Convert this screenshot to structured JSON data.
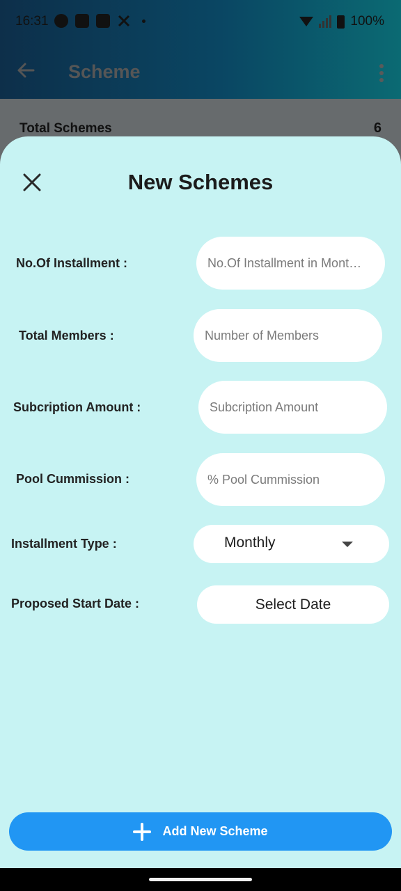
{
  "status_bar": {
    "time": "16:31",
    "battery": "100%"
  },
  "app_bar": {
    "title": "Scheme"
  },
  "summary": {
    "label": "Total Schemes",
    "value": "6"
  },
  "sheet": {
    "title": "New Schemes",
    "fields": {
      "installments": {
        "label": "No.Of Installment :",
        "placeholder": "No.Of Installment in Mont…",
        "value": ""
      },
      "members": {
        "label": "Total Members :",
        "placeholder": "Number of Members",
        "value": ""
      },
      "subscription": {
        "label": "Subcription Amount :",
        "placeholder": "Subcription Amount",
        "value": ""
      },
      "commission": {
        "label": "Pool Cummission :",
        "placeholder": "% Pool Cummission",
        "value": ""
      }
    },
    "installment_type": {
      "label": "Installment Type :",
      "selected": "Monthly"
    },
    "start_date": {
      "label": "Proposed Start Date :",
      "button": "Select Date"
    },
    "add_button": "Add New Scheme"
  },
  "icons": [
    "whatsapp-icon",
    "facebook-icon",
    "youtube-icon",
    "x-icon",
    "wifi-icon",
    "signal-icon",
    "battery-icon",
    "back-arrow-icon",
    "more-vert-icon",
    "close-icon",
    "dropdown-arrow-icon",
    "plus-icon"
  ],
  "colors": {
    "sheet_bg": "#c7f3f3",
    "primary": "#2196f3"
  }
}
